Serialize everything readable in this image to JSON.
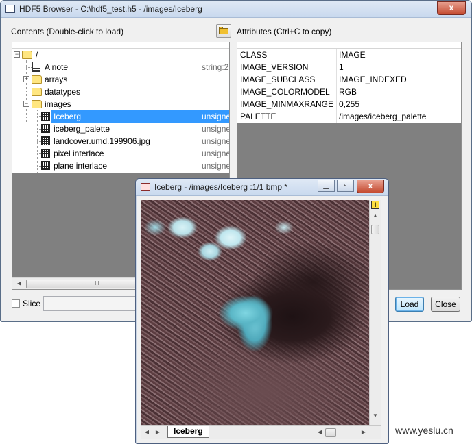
{
  "browser": {
    "title": "HDF5 Browser - C:\\hdf5_test.h5 - /images/Iceberg",
    "close_label": "x",
    "contents_label": "Contents (Double-click to load)",
    "attributes_label": "Attributes (Ctrl+C to copy)",
    "tree": [
      {
        "name": "/",
        "type": ""
      },
      {
        "name": "A note",
        "type": "string:2"
      },
      {
        "name": "arrays",
        "type": ""
      },
      {
        "name": "datatypes",
        "type": ""
      },
      {
        "name": "images",
        "type": ""
      },
      {
        "name": "Iceberg",
        "type": "unsigne"
      },
      {
        "name": "iceberg_palette",
        "type": "unsigne"
      },
      {
        "name": "landcover.umd.199906.jpg",
        "type": "unsigne"
      },
      {
        "name": "pixel interlace",
        "type": "unsigne"
      },
      {
        "name": "plane interlace",
        "type": "unsigne"
      }
    ],
    "expand_plus": "+",
    "expand_minus": "−",
    "scroll_grip": "III",
    "attributes": [
      {
        "key": "CLASS",
        "value": "IMAGE"
      },
      {
        "key": "IMAGE_VERSION",
        "value": "1"
      },
      {
        "key": "IMAGE_SUBCLASS",
        "value": "IMAGE_INDEXED"
      },
      {
        "key": "IMAGE_COLORMODEL",
        "value": "RGB"
      },
      {
        "key": "IMAGE_MINMAXRANGE",
        "value": "0,255"
      },
      {
        "key": "PALETTE",
        "value": "/images/iceberg_palette"
      }
    ],
    "slice_label": "Slice",
    "load_label": "Load",
    "close_button_label": "Close"
  },
  "image_window": {
    "title": "Iceberg - /images/Iceberg :1/1 bmp *",
    "minimize": "▁",
    "maximize": "▫",
    "close": "x",
    "sheet_tab": "Iceberg",
    "scroll_up": "▲",
    "scroll_down": "▼",
    "scroll_left": "◀",
    "scroll_right": "▶",
    "corner_badge": "I"
  },
  "watermark": "www.yeslu.cn"
}
